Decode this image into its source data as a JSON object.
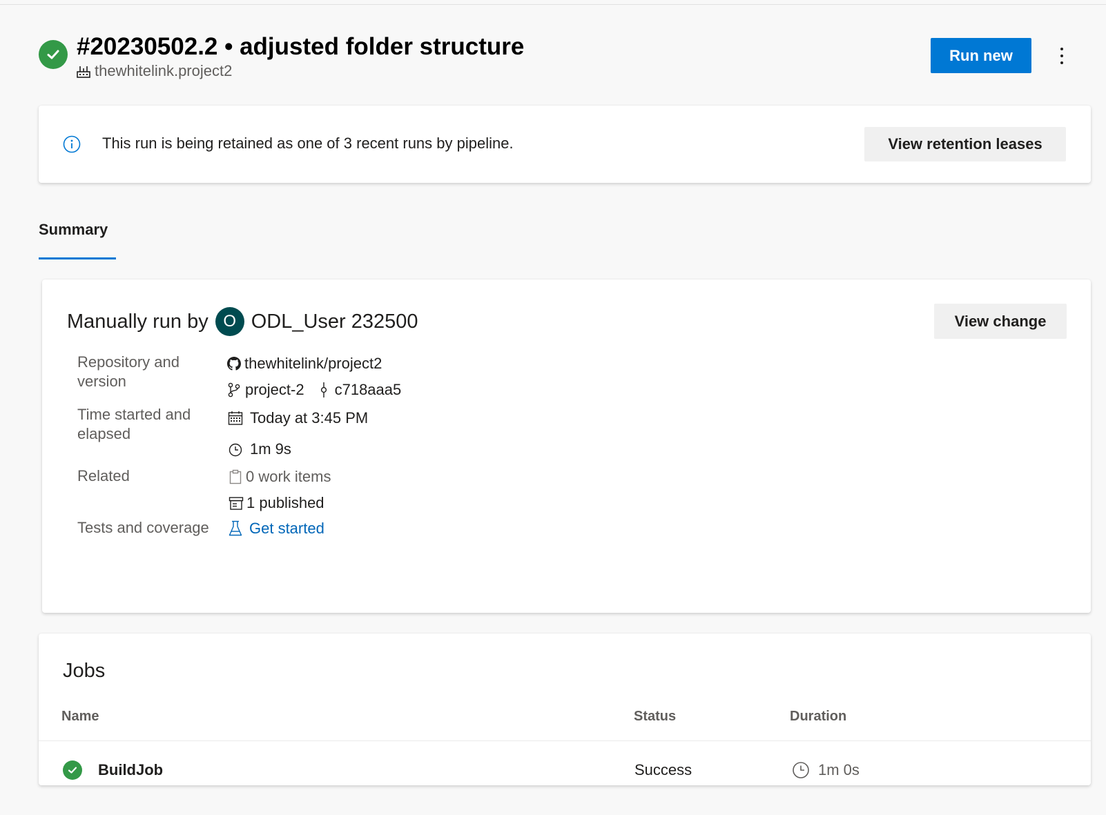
{
  "header": {
    "run_title": "#20230502.2 • adjusted folder structure",
    "pipeline_name": "thewhitelink.project2",
    "run_new_label": "Run new",
    "status": "succeeded"
  },
  "banner": {
    "text": "This run is being retained as one of 3 recent runs by pipeline.",
    "button_label": "View retention leases"
  },
  "tabs": [
    {
      "label": "Summary",
      "selected": true
    }
  ],
  "summary": {
    "run_by_prefix": "Manually run by",
    "avatar_initial": "O",
    "user_name": "ODL_User 232500",
    "view_change_label": "View change",
    "repo_label": "Repository and version",
    "repo_name": "thewhitelink/project2",
    "branch": "project-2",
    "commit": "c718aaa5",
    "time_label": "Time started and elapsed",
    "started": "Today at 3:45 PM",
    "elapsed": "1m 9s",
    "related_label": "Related",
    "work_items": "0 work items",
    "published": "1 published",
    "tests_label": "Tests and coverage",
    "tests_link": "Get started"
  },
  "jobs": {
    "title": "Jobs",
    "columns": [
      "Name",
      "Status",
      "Duration"
    ],
    "rows": [
      {
        "name": "BuildJob",
        "status": "Success",
        "duration": "1m 0s"
      }
    ]
  },
  "colors": {
    "primary": "#0078d4",
    "success": "#339947",
    "avatar": "#004b50",
    "link": "#0066b8"
  },
  "icons": {
    "status": "check-circle-icon",
    "pipeline": "pipeline-icon",
    "info": "info-icon",
    "repo": "github-icon",
    "branch": "branch-icon",
    "commit": "commit-icon",
    "calendar": "calendar-icon",
    "clock": "clock-icon",
    "work_items": "clipboard-icon",
    "published": "artifact-icon",
    "tests": "flask-icon"
  }
}
